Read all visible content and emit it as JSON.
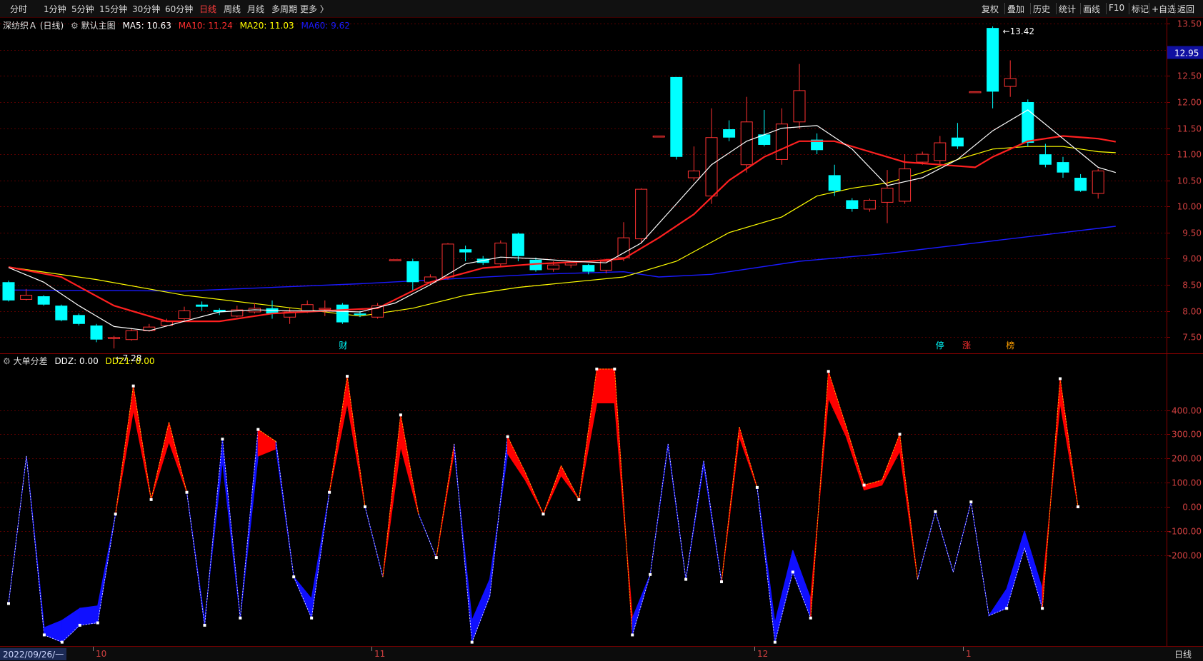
{
  "toolbar": {
    "left": [
      "分时",
      "1分钟",
      "5分钟",
      "15分钟",
      "30分钟",
      "60分钟",
      "日线",
      "周线",
      "月线",
      "多周期",
      "更多 〉"
    ],
    "active": "日线",
    "right": [
      "复权",
      "叠加",
      "历史",
      "统计",
      "画线",
      "F10",
      "标记",
      "+自选",
      "返回"
    ]
  },
  "main_legend": {
    "stock": "深纺织Ａ (日线)",
    "indicator": "默认主图",
    "ma5": "MA5: 10.63",
    "ma10": "MA10: 11.24",
    "ma20": "MA20: 11.03",
    "ma60": "MA60: 9.62"
  },
  "sub_legend": {
    "indicator": "大单分差",
    "ddz": "DDZ: 0.00",
    "ddz1": "DDZ1: 0.00"
  },
  "price_axis": [
    "13.50",
    "13.00",
    "12.50",
    "12.00",
    "11.50",
    "11.00",
    "10.50",
    "10.00",
    "9.50",
    "9.00",
    "8.50",
    "8.00",
    "7.50"
  ],
  "current_price": "12.95",
  "high_label": "13.42",
  "low_label": "7.28",
  "markers": [
    "财",
    "停",
    "涨",
    "榜"
  ],
  "sub_axis": [
    "400.00",
    "300.00",
    "200.00",
    "100.00",
    "0.00",
    "-100.00",
    "-200.00"
  ],
  "date_axis": {
    "start": "2022/09/26/一",
    "months": [
      "10",
      "11",
      "12",
      "1"
    ],
    "period": "日线"
  },
  "colors": {
    "up": "#ff3232",
    "down": "#00ffff",
    "ma5": "#ffffff",
    "ma10": "#ff2020",
    "ma20": "#ffff00",
    "ma60": "#1a1aff",
    "ddz_pos": "#ff0000",
    "ddz_neg": "#1010ff"
  },
  "chart_data": [
    {
      "type": "candlestick",
      "title": "深纺织Ａ (日线)",
      "ylim": [
        7.2,
        13.6
      ],
      "candles": [
        [
          8.55,
          8.2,
          8.58,
          8.18
        ],
        [
          8.22,
          8.3,
          8.42,
          8.2
        ],
        [
          8.28,
          8.12,
          8.3,
          8.1
        ],
        [
          8.1,
          7.82,
          8.12,
          7.8
        ],
        [
          7.92,
          7.75,
          7.95,
          7.72
        ],
        [
          7.72,
          7.45,
          7.75,
          7.4
        ],
        [
          7.48,
          7.49,
          7.52,
          7.28
        ],
        [
          7.45,
          7.62,
          7.66,
          7.43
        ],
        [
          7.62,
          7.69,
          7.75,
          7.6
        ],
        [
          7.72,
          7.8,
          7.85,
          7.7
        ],
        [
          7.85,
          8.0,
          8.08,
          7.82
        ],
        [
          8.12,
          8.08,
          8.18,
          8.0
        ],
        [
          8.02,
          7.98,
          8.05,
          7.92
        ],
        [
          7.9,
          8.02,
          8.1,
          7.88
        ],
        [
          7.98,
          8.05,
          8.15,
          7.95
        ],
        [
          8.05,
          7.95,
          8.2,
          7.85
        ],
        [
          7.88,
          7.98,
          8.05,
          7.75
        ],
        [
          8.0,
          8.12,
          8.2,
          7.96
        ],
        [
          8.05,
          8.05,
          8.2,
          7.9
        ],
        [
          8.12,
          7.78,
          8.15,
          7.75
        ],
        [
          7.95,
          7.92,
          8.0,
          7.88
        ],
        [
          7.88,
          8.1,
          8.15,
          7.85
        ],
        [
          8.98,
          8.98,
          8.98,
          8.98
        ],
        [
          8.95,
          8.55,
          9.0,
          8.4
        ],
        [
          8.55,
          8.65,
          8.7,
          8.5
        ],
        [
          8.65,
          9.28,
          9.3,
          8.6
        ],
        [
          9.18,
          9.12,
          9.25,
          8.95
        ],
        [
          9.0,
          8.92,
          9.05,
          8.88
        ],
        [
          8.9,
          9.3,
          9.35,
          8.85
        ],
        [
          9.48,
          9.05,
          9.5,
          8.95
        ],
        [
          8.98,
          8.78,
          9.02,
          8.75
        ],
        [
          8.8,
          8.88,
          8.95,
          8.75
        ],
        [
          8.88,
          8.92,
          8.95,
          8.82
        ],
        [
          8.88,
          8.75,
          8.9,
          8.7
        ],
        [
          8.78,
          8.95,
          9.0,
          8.72
        ],
        [
          9.02,
          9.4,
          9.7,
          8.95
        ],
        [
          9.38,
          10.33,
          10.35,
          9.3
        ],
        [
          11.35,
          11.35,
          11.35,
          11.35
        ],
        [
          12.48,
          10.95,
          12.48,
          10.9
        ],
        [
          10.55,
          10.68,
          11.15,
          10.5
        ],
        [
          10.2,
          11.32,
          11.88,
          10.05
        ],
        [
          11.48,
          11.32,
          11.65,
          11.25
        ],
        [
          10.8,
          11.62,
          12.1,
          10.65
        ],
        [
          11.38,
          11.18,
          11.85,
          11.15
        ],
        [
          10.9,
          11.58,
          11.88,
          10.8
        ],
        [
          11.62,
          12.22,
          12.73,
          11.48
        ],
        [
          11.28,
          11.08,
          11.4,
          11.0
        ],
        [
          10.6,
          10.3,
          10.8,
          10.2
        ],
        [
          10.12,
          9.95,
          10.16,
          9.9
        ],
        [
          9.95,
          10.12,
          10.15,
          9.9
        ],
        [
          10.08,
          10.35,
          10.7,
          9.68
        ],
        [
          10.1,
          10.72,
          11.0,
          10.05
        ],
        [
          10.85,
          11.0,
          11.05,
          10.8
        ],
        [
          10.88,
          11.22,
          11.35,
          10.8
        ],
        [
          11.32,
          11.15,
          11.6,
          11.1
        ],
        [
          12.2,
          12.2,
          12.2,
          12.2
        ],
        [
          13.42,
          12.2,
          13.45,
          11.88
        ],
        [
          12.3,
          12.45,
          12.8,
          12.1
        ],
        [
          12.0,
          11.22,
          12.05,
          11.15
        ],
        [
          11.0,
          10.8,
          11.2,
          10.75
        ],
        [
          10.85,
          10.65,
          10.95,
          10.55
        ],
        [
          10.55,
          10.3,
          10.62,
          10.28
        ],
        [
          10.25,
          10.68,
          10.72,
          10.15
        ]
      ],
      "ma5": [
        [
          0,
          8.83
        ],
        [
          2,
          8.55
        ],
        [
          4,
          8.1
        ],
        [
          6,
          7.7
        ],
        [
          8,
          7.62
        ],
        [
          10,
          7.8
        ],
        [
          12,
          7.98
        ],
        [
          14,
          8.02
        ],
        [
          16,
          8.0
        ],
        [
          18,
          8.0
        ],
        [
          20,
          7.98
        ],
        [
          22,
          8.15
        ],
        [
          24,
          8.5
        ],
        [
          26,
          8.9
        ],
        [
          28,
          9.03
        ],
        [
          30,
          9.0
        ],
        [
          32,
          8.95
        ],
        [
          34,
          8.92
        ],
        [
          36,
          9.3
        ],
        [
          38,
          10.05
        ],
        [
          40,
          10.8
        ],
        [
          42,
          11.25
        ],
        [
          44,
          11.5
        ],
        [
          46,
          11.55
        ],
        [
          48,
          11.1
        ],
        [
          50,
          10.4
        ],
        [
          52,
          10.55
        ],
        [
          54,
          10.9
        ],
        [
          56,
          11.45
        ],
        [
          58,
          11.85
        ],
        [
          60,
          11.3
        ],
        [
          62,
          10.75
        ],
        [
          63,
          10.65
        ]
      ],
      "ma10": [
        [
          0,
          8.84
        ],
        [
          3,
          8.65
        ],
        [
          6,
          8.1
        ],
        [
          9,
          7.8
        ],
        [
          12,
          7.8
        ],
        [
          15,
          7.95
        ],
        [
          18,
          8.0
        ],
        [
          21,
          8.05
        ],
        [
          24,
          8.55
        ],
        [
          27,
          8.82
        ],
        [
          30,
          8.9
        ],
        [
          33,
          8.95
        ],
        [
          35,
          9.0
        ],
        [
          37,
          9.4
        ],
        [
          39,
          9.85
        ],
        [
          41,
          10.5
        ],
        [
          43,
          10.95
        ],
        [
          45,
          11.25
        ],
        [
          47,
          11.25
        ],
        [
          49,
          11.05
        ],
        [
          51,
          10.85
        ],
        [
          53,
          10.8
        ],
        [
          55,
          10.75
        ],
        [
          56,
          10.95
        ],
        [
          58,
          11.25
        ],
        [
          60,
          11.35
        ],
        [
          62,
          11.3
        ],
        [
          63,
          11.24
        ]
      ],
      "ma20": [
        [
          0,
          8.84
        ],
        [
          5,
          8.6
        ],
        [
          10,
          8.3
        ],
        [
          15,
          8.1
        ],
        [
          20,
          7.9
        ],
        [
          23,
          8.05
        ],
        [
          26,
          8.3
        ],
        [
          29,
          8.45
        ],
        [
          32,
          8.55
        ],
        [
          35,
          8.65
        ],
        [
          38,
          8.95
        ],
        [
          41,
          9.5
        ],
        [
          44,
          9.8
        ],
        [
          46,
          10.2
        ],
        [
          48,
          10.35
        ],
        [
          50,
          10.45
        ],
        [
          52,
          10.65
        ],
        [
          54,
          10.9
        ],
        [
          56,
          11.1
        ],
        [
          58,
          11.15
        ],
        [
          60,
          11.15
        ],
        [
          62,
          11.05
        ],
        [
          63,
          11.03
        ]
      ],
      "ma60": [
        [
          0,
          8.4
        ],
        [
          10,
          8.38
        ],
        [
          20,
          8.52
        ],
        [
          30,
          8.7
        ],
        [
          35,
          8.75
        ],
        [
          37,
          8.65
        ],
        [
          40,
          8.7
        ],
        [
          45,
          8.95
        ],
        [
          50,
          9.1
        ],
        [
          55,
          9.3
        ],
        [
          60,
          9.5
        ],
        [
          63,
          9.62
        ]
      ]
    },
    {
      "type": "area",
      "title": "大单分差",
      "ylim": [
        -570,
        570
      ],
      "series": [
        {
          "name": "DDZ",
          "values": [
            -400,
            210,
            -530,
            -560,
            -490,
            -480,
            -30,
            500,
            30,
            350,
            60,
            -490,
            280,
            -460,
            320,
            270,
            -290,
            -460,
            60,
            540,
            0,
            -290,
            380,
            -30,
            -210,
            260,
            -560,
            -370,
            290,
            140,
            -30,
            170,
            30,
            570,
            570,
            -530,
            -280,
            260,
            -300,
            190,
            -310,
            330,
            80,
            -560,
            -270,
            -460,
            560,
            330,
            90,
            110,
            300,
            -300,
            -20,
            -270,
            20,
            -450,
            -420,
            -170,
            -420,
            530,
            0
          ]
        },
        {
          "name": "DDZ1",
          "values": [
            -400,
            210,
            -500,
            -470,
            -420,
            -410,
            -30,
            400,
            30,
            270,
            60,
            -470,
            190,
            -460,
            210,
            240,
            -290,
            -380,
            60,
            430,
            0,
            -290,
            250,
            -30,
            -210,
            230,
            -470,
            -300,
            220,
            110,
            -30,
            130,
            30,
            430,
            430,
            -460,
            -280,
            250,
            -300,
            170,
            -310,
            290,
            80,
            -480,
            -180,
            -380,
            450,
            290,
            70,
            90,
            230,
            -300,
            -20,
            -270,
            20,
            -450,
            -340,
            -100,
            -340,
            430,
            0
          ]
        }
      ]
    }
  ]
}
